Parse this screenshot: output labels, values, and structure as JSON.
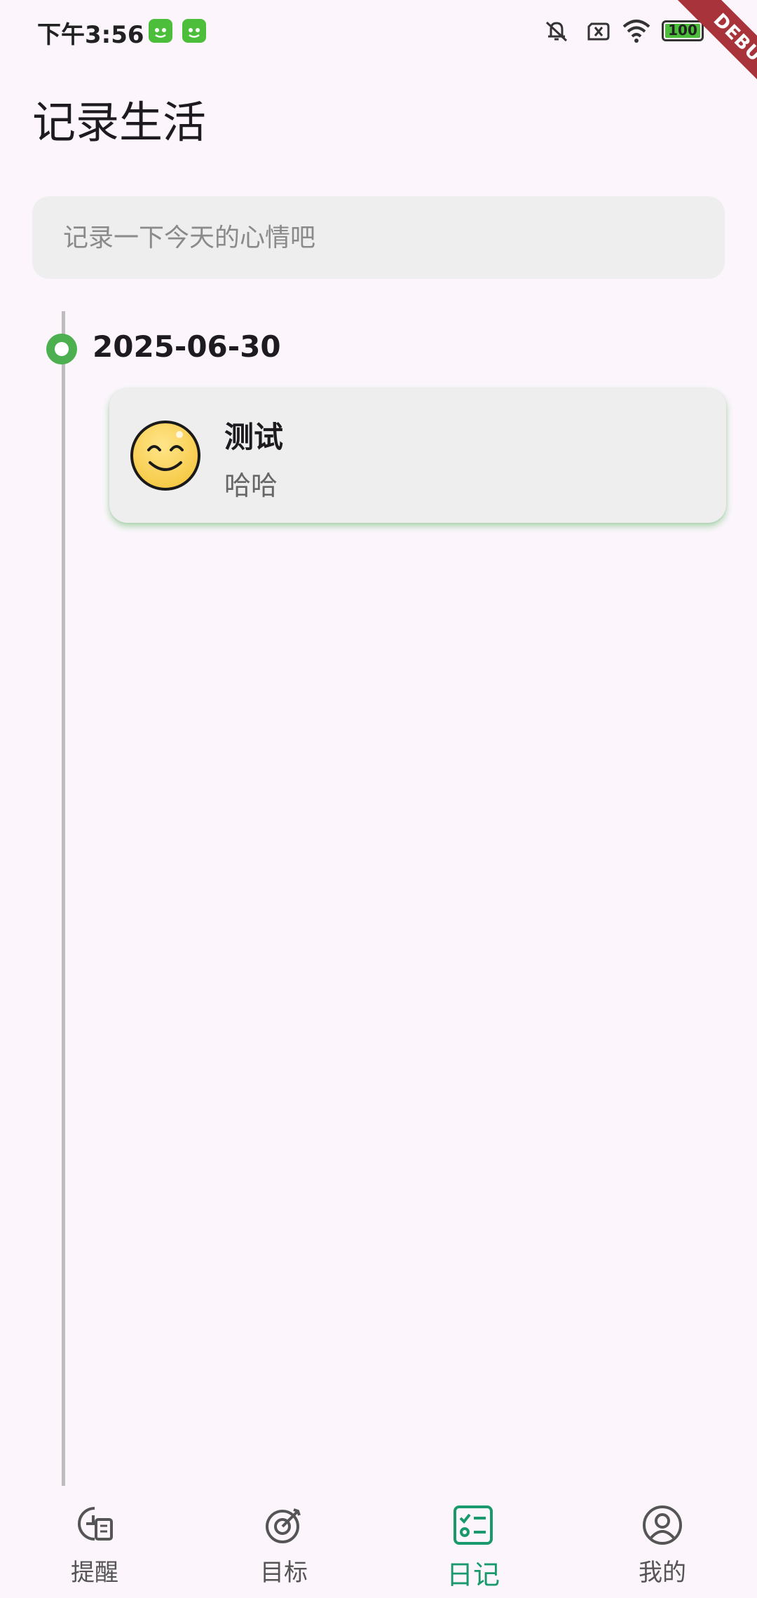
{
  "status_bar": {
    "time": "下午3:56",
    "battery": "100"
  },
  "debug_banner": "DEBUG",
  "page": {
    "title": "记录生活"
  },
  "mood_input": {
    "placeholder": "记录一下今天的心情吧",
    "value": ""
  },
  "timeline": {
    "groups": [
      {
        "date": "2025-06-30",
        "entries": [
          {
            "icon": "smiley-face-icon",
            "title": "测试",
            "body": "哈哈"
          }
        ]
      }
    ]
  },
  "bottom_nav": {
    "items": [
      {
        "label": "提醒",
        "icon": "reminder-icon",
        "active": false
      },
      {
        "label": "目标",
        "icon": "target-icon",
        "active": false
      },
      {
        "label": "日记",
        "icon": "diary-checklist-icon",
        "active": true
      },
      {
        "label": "我的",
        "icon": "profile-icon",
        "active": false
      }
    ]
  },
  "colors": {
    "background": "#fcf6fc",
    "accent_green": "#4caf50",
    "active_nav": "#1a9a6c",
    "card": "#eeeeee"
  }
}
